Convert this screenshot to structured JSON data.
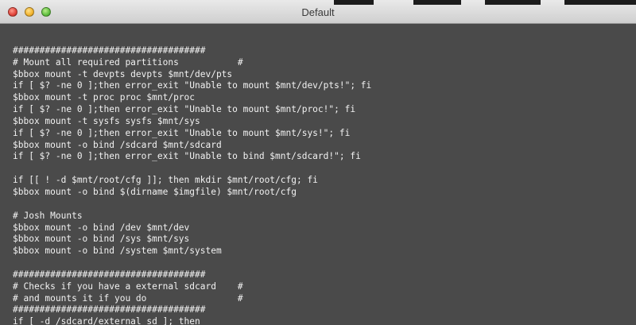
{
  "window": {
    "title": "Default"
  },
  "terminal": {
    "lines": [
      "",
      "####################################",
      "# Mount all required partitions           #",
      "$bbox mount -t devpts devpts $mnt/dev/pts",
      "if [ $? -ne 0 ];then error_exit \"Unable to mount $mnt/dev/pts!\"; fi",
      "$bbox mount -t proc proc $mnt/proc",
      "if [ $? -ne 0 ];then error_exit \"Unable to mount $mnt/proc!\"; fi",
      "$bbox mount -t sysfs sysfs $mnt/sys",
      "if [ $? -ne 0 ];then error_exit \"Unable to mount $mnt/sys!\"; fi",
      "$bbox mount -o bind /sdcard $mnt/sdcard",
      "if [ $? -ne 0 ];then error_exit \"Unable to bind $mnt/sdcard!\"; fi",
      "",
      "if [[ ! -d $mnt/root/cfg ]]; then mkdir $mnt/root/cfg; fi",
      "$bbox mount -o bind $(dirname $imgfile) $mnt/root/cfg",
      "",
      "# Josh Mounts",
      "$bbox mount -o bind /dev $mnt/dev",
      "$bbox mount -o bind /sys $mnt/sys",
      "$bbox mount -o bind /system $mnt/system",
      "",
      "####################################",
      "# Checks if you have a external sdcard    #",
      "# and mounts it if you do                 #",
      "####################################",
      "if [ -d /sdcard/external_sd ]; then"
    ]
  }
}
